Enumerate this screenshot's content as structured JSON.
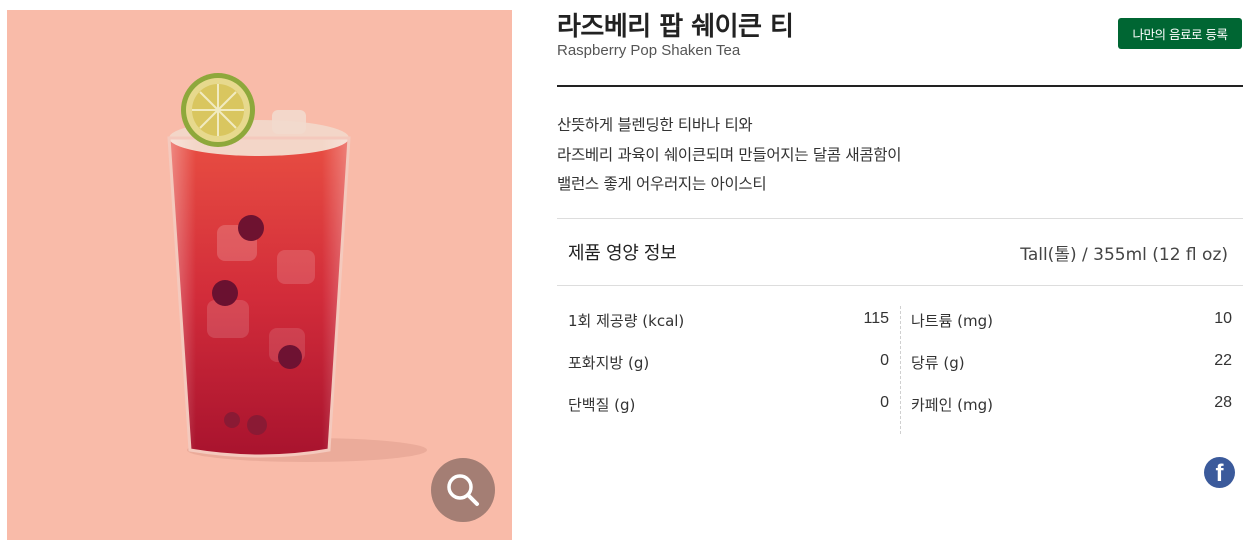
{
  "product": {
    "name_ko": "라즈베리 팝 쉐이큰 티",
    "name_en": "Raspberry Pop Shaken Tea",
    "register_label": "나만의 음료로 등록",
    "description": [
      "산뜻하게 블렌딩한 티바나 티와",
      "라즈베리 과육이 쉐이큰되며 만들어지는 달콤 새콤함이",
      "밸런스 좋게 어우러지는 아이스티"
    ]
  },
  "nutrition": {
    "title": "제품 영양 정보",
    "size": "Tall(톨) / 355ml (12 fl oz)",
    "left": [
      {
        "label": "1회 제공량 (kcal)",
        "value": "115"
      },
      {
        "label": "포화지방 (g)",
        "value": "0"
      },
      {
        "label": "단백질 (g)",
        "value": "0"
      }
    ],
    "right": [
      {
        "label": "나트륨 (mg)",
        "value": "10"
      },
      {
        "label": "당류 (g)",
        "value": "22"
      },
      {
        "label": "카페인 (mg)",
        "value": "28"
      }
    ]
  },
  "colors": {
    "photo_background": "#f9bba9",
    "register_button": "#006633",
    "zoom_button": "#a47e74",
    "facebook": "#3b5a9b"
  },
  "icons": {
    "zoom": "magnifier-icon",
    "share": "facebook-icon"
  }
}
